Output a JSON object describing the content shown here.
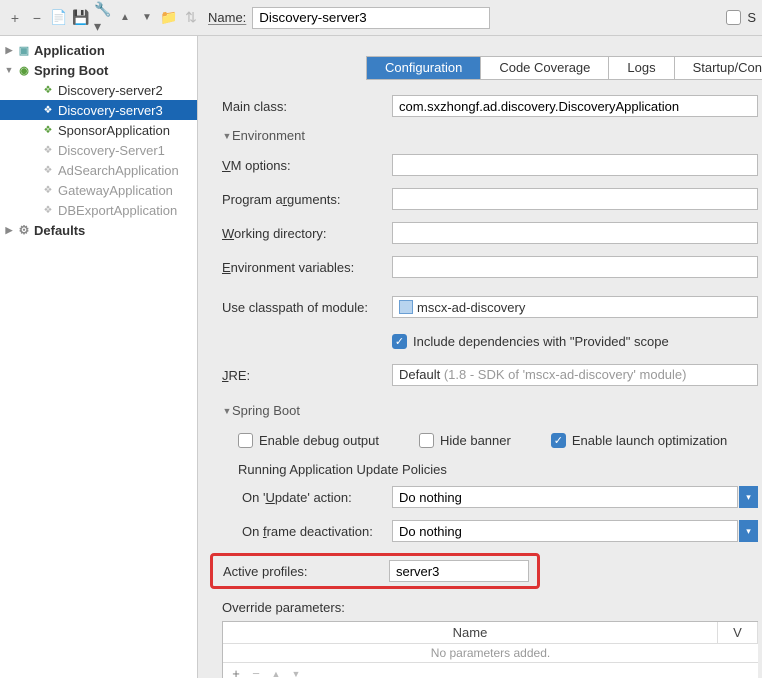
{
  "toolbar": {
    "name_label": "Name:",
    "name_value": "Discovery-server3",
    "store_checkbox": "S"
  },
  "sidebar": {
    "nodes": [
      {
        "label": "Application",
        "type": "app",
        "bold": true,
        "depth": 0,
        "twist": "▶"
      },
      {
        "label": "Spring Boot",
        "type": "spring",
        "bold": true,
        "depth": 0,
        "twist": "▼"
      },
      {
        "label": "Discovery-server2",
        "type": "leaf",
        "depth": 1
      },
      {
        "label": "Discovery-server3",
        "type": "leaf",
        "depth": 1,
        "selected": true
      },
      {
        "label": "SponsorApplication",
        "type": "leaf",
        "depth": 1
      },
      {
        "label": "Discovery-Server1",
        "type": "leafg",
        "depth": 1,
        "grey": true
      },
      {
        "label": "AdSearchApplication",
        "type": "leafg",
        "depth": 1,
        "grey": true
      },
      {
        "label": "GatewayApplication",
        "type": "leafg",
        "depth": 1,
        "grey": true
      },
      {
        "label": "DBExportApplication",
        "type": "leafg",
        "depth": 1,
        "grey": true
      },
      {
        "label": "Defaults",
        "type": "def",
        "bold": true,
        "depth": 0,
        "twist": "▶"
      }
    ]
  },
  "tabs": [
    "Configuration",
    "Code Coverage",
    "Logs",
    "Startup/Connecti"
  ],
  "form": {
    "main_class_label": "Main class:",
    "main_class_value": "com.sxzhongf.ad.discovery.DiscoveryApplication",
    "env_header": "Environment",
    "vm_label": "VM options:",
    "args_label": "Program arguments:",
    "workdir_label": "Working directory:",
    "envvar_label": "Environment variables:",
    "classpath_label": "Use classpath of module:",
    "classpath_value": "mscx-ad-discovery",
    "include_provided": "Include dependencies with \"Provided\" scope",
    "jre_label": "JRE:",
    "jre_value": "Default",
    "jre_hint": "(1.8 - SDK of 'mscx-ad-discovery' module)",
    "springboot_header": "Spring Boot",
    "enable_debug": "Enable debug output",
    "hide_banner": "Hide banner",
    "enable_launch_opt": "Enable launch optimization",
    "update_policies_header": "Running Application Update Policies",
    "on_update_label": "On 'Update' action:",
    "on_frame_label": "On frame deactivation:",
    "do_nothing": "Do nothing",
    "active_profiles_label": "Active profiles:",
    "active_profiles_value": "server3",
    "override_params_label": "Override parameters:",
    "th_name": "Name",
    "th_value": "V",
    "no_params": "No parameters added."
  }
}
